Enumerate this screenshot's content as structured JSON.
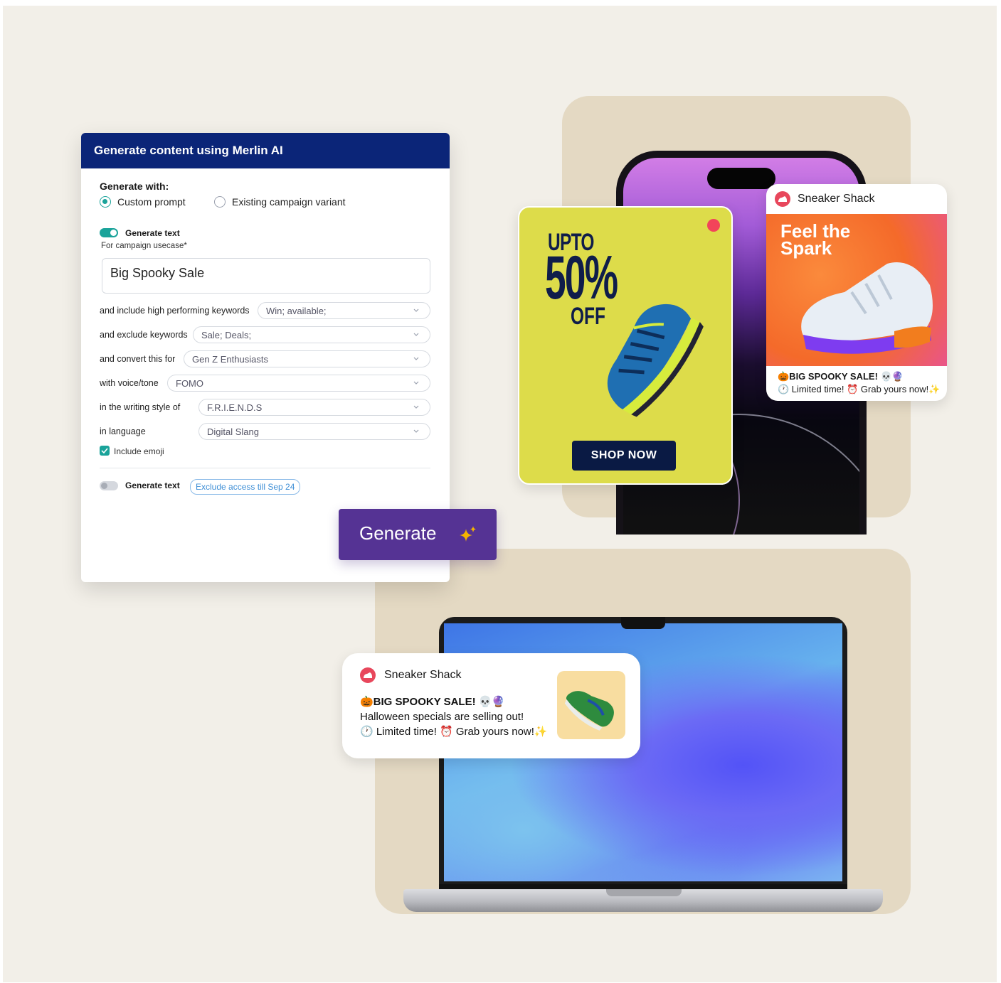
{
  "form": {
    "title": "Generate content using Merlin AI",
    "generate_with_label": "Generate with:",
    "radio_options": [
      {
        "label": "Custom prompt",
        "selected": true
      },
      {
        "label": "Existing campaign variant",
        "selected": false
      }
    ],
    "generate_text_label": "Generate text",
    "generate_text_enabled": true,
    "usecase_label": "For campaign usecase*",
    "usecase_value": "Big Spooky Sale",
    "fields": [
      {
        "label": "and include high performing keywords",
        "value": "Win; available;"
      },
      {
        "label": "and exclude keywords",
        "value": "Sale; Deals;"
      },
      {
        "label": "and convert this for",
        "value": "Gen Z Enthusiasts"
      },
      {
        "label": "with voice/tone",
        "value": "FOMO"
      },
      {
        "label": "in the writing style of",
        "value": "F.R.I.E.N.D.S"
      },
      {
        "label": "in language",
        "value": "Digital Slang"
      }
    ],
    "include_emoji_label": "Include emoji",
    "include_emoji_checked": true,
    "generate_text_2_label": "Generate text",
    "generate_text_2_enabled": false,
    "exclude_chip": "Exclude access till Sep 24",
    "generate_button": "Generate"
  },
  "ad_card": {
    "upto": "UPTO",
    "percent": "50%",
    "off": "OFF",
    "button": "SHOP NOW"
  },
  "push_card": {
    "brand": "Sneaker Shack",
    "headline": "Feel the",
    "headline2": "Spark",
    "line1": "🎃BIG SPOOKY SALE! 💀🔮",
    "line2": "🕐 Limited time! ⏰ Grab yours now!✨"
  },
  "desktop_notification": {
    "brand": "Sneaker Shack",
    "line1": "🎃BIG SPOOKY SALE! 💀🔮",
    "line2": "Halloween specials are selling out!",
    "line3": "🕐 Limited time! ⏰ Grab yours now!✨"
  },
  "colors": {
    "canvas": "#f2efe8",
    "panel": "#e4d9c3",
    "form_header": "#0b2578",
    "accent_teal": "#1aa39a",
    "generate_button": "#553394",
    "ad_background": "#dddc4a",
    "ad_text": "#0f1d4a"
  }
}
